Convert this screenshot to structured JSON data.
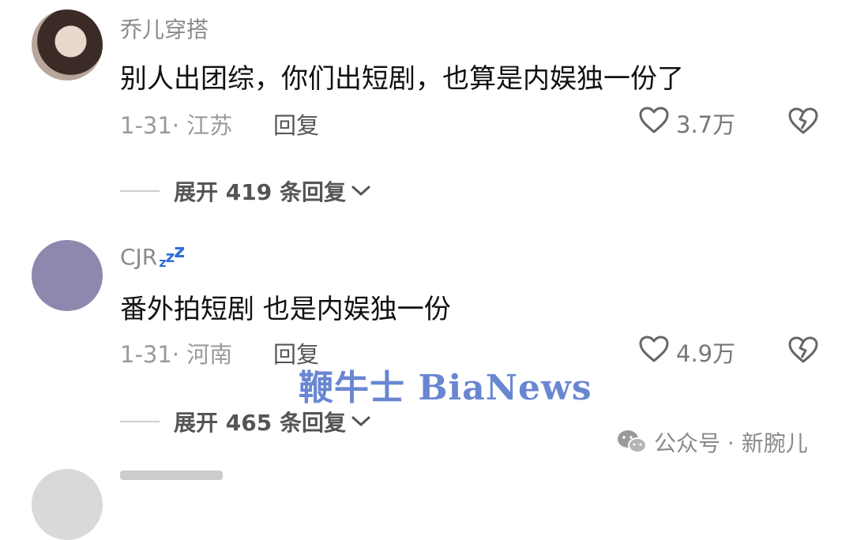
{
  "comments": [
    {
      "username": "乔儿穿搭",
      "text": "别人出团综，你们出短剧，也算是内娱独一份了",
      "date_location": "1-31· 江苏",
      "reply_label": "回复",
      "likes": "3.7万",
      "expand_label": "展开 419 条回复"
    },
    {
      "username": "CJR",
      "text": "番外拍短剧 也是内娱独一份",
      "date_location": "1-31· 河南",
      "reply_label": "回复",
      "likes": "4.9万",
      "expand_label": "展开 465 条回复"
    }
  ],
  "watermark": "鞭牛士 BiaNews",
  "footer": {
    "label": "公众号 · 新腕儿"
  },
  "icons": {
    "like": "heart-outline-icon",
    "dislike": "broken-heart-icon",
    "expand": "chevron-down-icon",
    "wechat": "wechat-icon",
    "sleep": "zzz-badge-icon"
  },
  "colors": {
    "accent_blue": "#2f6fd6",
    "watermark_blue": "#4f72c9"
  }
}
